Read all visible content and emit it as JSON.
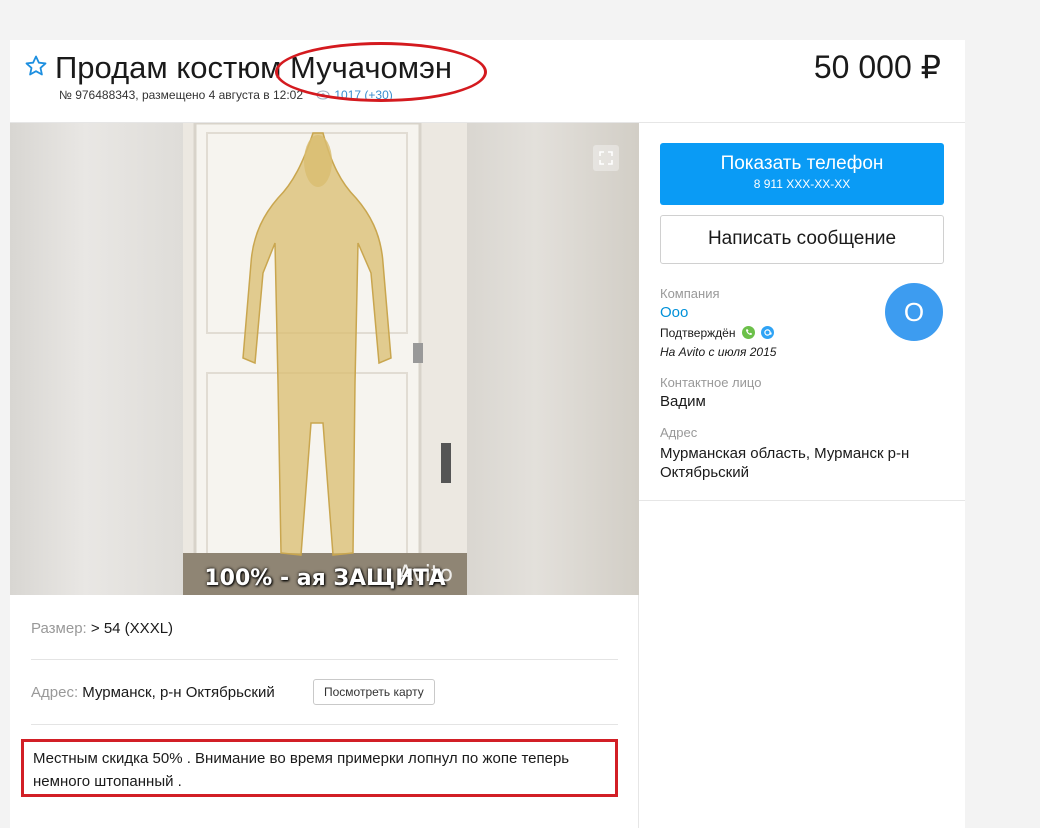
{
  "listing": {
    "title": "Продам костюм Мучачомэн",
    "meta_text": "№ 976488343, размещено 4 августа в 12:02",
    "views": "1017 (+30)",
    "price": "50 000 ₽"
  },
  "photo": {
    "caption": "100% - ая ЗАЩИТА",
    "watermark": "Avito"
  },
  "params": {
    "size_label": "Размер:",
    "size_value": "> 54 (XXXL)",
    "address_label": "Адрес:",
    "address_value": "Мурманск, р-н Октябрьский",
    "map_button": "Посмотреть карту"
  },
  "description": "Местным скидка 50% . Внимание во время примерки лопнул по жопе теперь немного штопанный .",
  "sidebar": {
    "phone_button_label": "Показать телефон",
    "phone_number": "8 911 XXX-XX-XX",
    "message_button": "Написать сообщение",
    "company_label": "Компания",
    "company_name": "Ооо",
    "verified_text": "Подтверждён",
    "since_text": "На Avito с июля 2015",
    "avatar_letter": "О",
    "contact_label": "Контактное лицо",
    "contact_name": "Вадим",
    "address_label": "Адрес",
    "address_value": "Мурманская область, Мурманск р-н Октябрьский"
  },
  "colors": {
    "accent_blue": "#0a9bf5",
    "link_blue": "#0091d9",
    "annotation_red": "#d21f26",
    "verified_green": "#6cc04a",
    "verified_blue": "#2fa3f5"
  }
}
